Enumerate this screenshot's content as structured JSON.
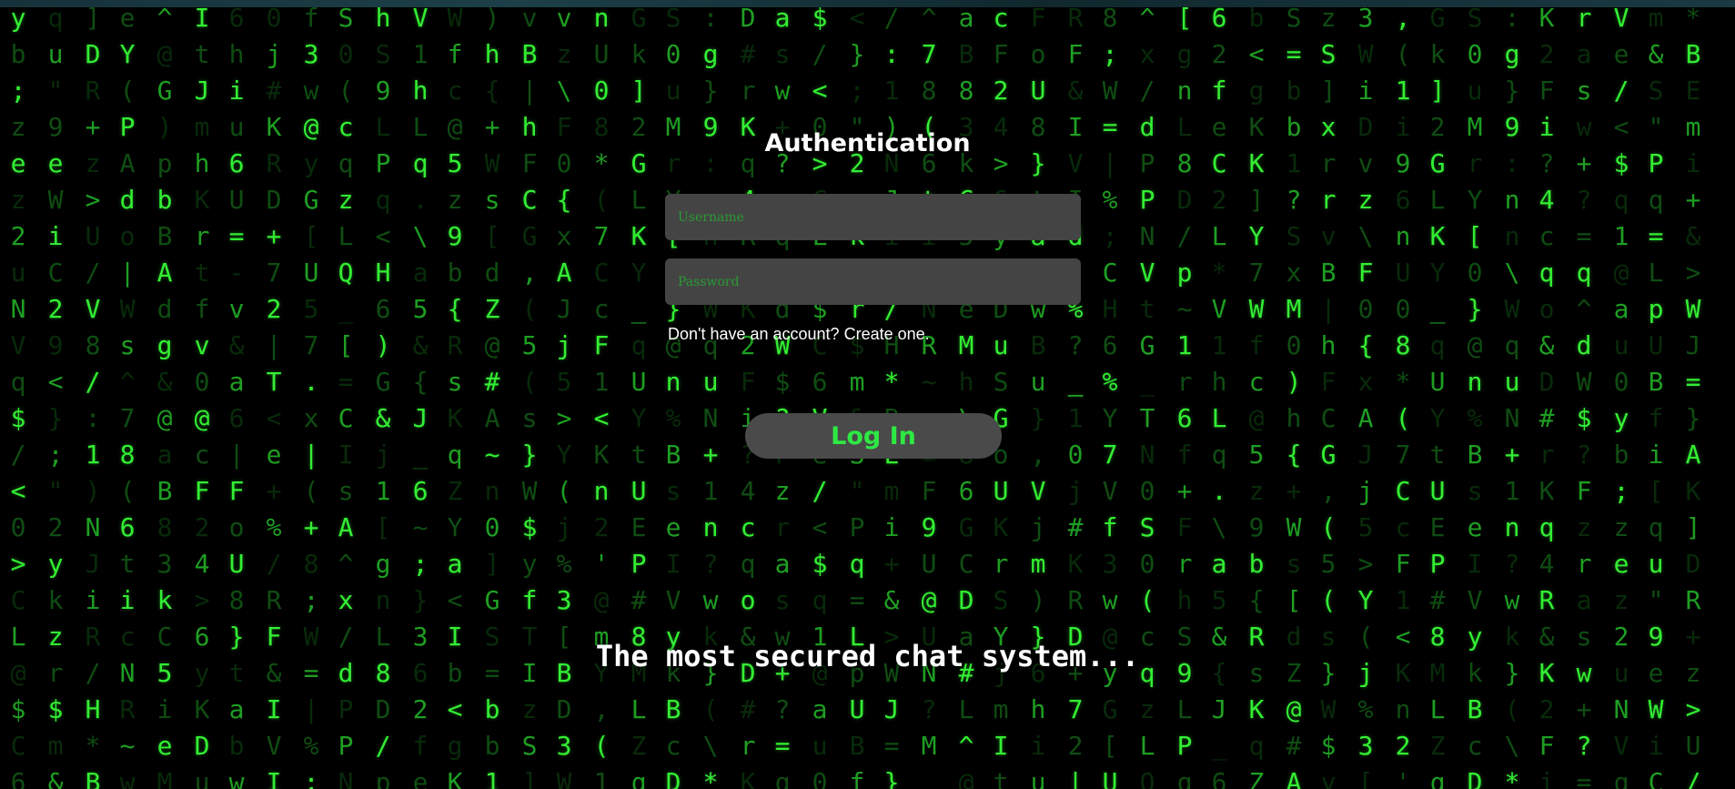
{
  "colors": {
    "background": "#000000",
    "matrix_bright": "#33ee33",
    "matrix_dim": "#0f4d12",
    "field_background": "#444444",
    "button_background": "#4a4a4a",
    "button_text": "#2ee843",
    "heading_text": "#ffffff"
  },
  "auth": {
    "title": "Authentication",
    "username_placeholder": "Username",
    "password_placeholder": "Password",
    "signup_text": "Don't have an account? Create one.",
    "login_label": "Log In"
  },
  "tagline": "The most secured chat system...",
  "background": {
    "effect": "matrix-digital-rain",
    "columns": [
      "y!b;zez2u!N!Vq!$!/<0>CL!@$C!6V!e!/<$q!1@!a!u!0",
      "i[qu\"9eWi!C!2!9<!};\"!2yk!zr!$!m!&!S\"P!q=LpUBf",
      "=}AK]DR+z>!U!/!V8/!:!1!)N!J!i!R!/H*B!Em!i+&>WJ",
      "N?M_=teY(!P!A!d!o|W!s^!7!8!(!6!ticN!R~w=F9U@U",
      "86GCDa#L^!@!G!)!pbB!Ad!g!&!@!aB8!3!kC!5ieMh\\",
      "SGoUKrSYj!m!I!t!Jmh!Kr!t!f!v!0@c!F!24>6yKDu",
      "abwBu}!,V!j!m!)!}!6!hi!u!6!U!=!-v&!a6|FoU8}t",
      "%/R!F&IV!I!d!*!%!?!_!1!0!j!#!KRD!!+72|T<e+",
      "(+8;!!W=|!%;CH6%!Y!!7!V!f!3!w@yG![U57!.x|",
      "CIsA^x/d!P!P!N!V!t!G!_!T!N!0!S!0!(!cq!zL!!Q_[=",
      "G&j1![gn!L!8!D!/p~!1r6f+!F!r!h!S!9!LP!q<!!H6)",
      "q!.\\a5!&{!J!_!6!~!;}362f!e!C!2!L!*!V!1!h!L",
      "c@5z9b{Rs!K!q!Z!Y!a<I!b<g!K!K]Y!7!W!f",
      "h{+Ws!![!d!Z!@!#A~n0]GS!=b!b!1?Sx!M!0!)",
      "xrrv!!B|!h!F!C!G,!(5(s!}W!$y!fTI!z!S!]",
      "BD3Wi!D!vz!\\!F!0!{!xA!J!j5!>!Y(j!%!3![",
      "Y,(1i!9!6!n!U!0!8!*(7C!c!F!1!<!Kn2!'!@!m",
      "UYt!U!E!P!#8!M!L!Z!q!G!k!]!2!G!L!K!Y!_!q",
      "}@n%B!s!e!I!V!y!k!B!c!D!S!0!u!M!r!Y![!0",
      "n\\Wq!u!N+1n!?!w!k!}!(!\\!*!:g!}!9!:!n",
      "cq!o!&!D#r!K!q!4R&!K!2!F!i!?!4",
      "+?=q^dW$?F!z!r!a!s!w!!"
    ]
  }
}
